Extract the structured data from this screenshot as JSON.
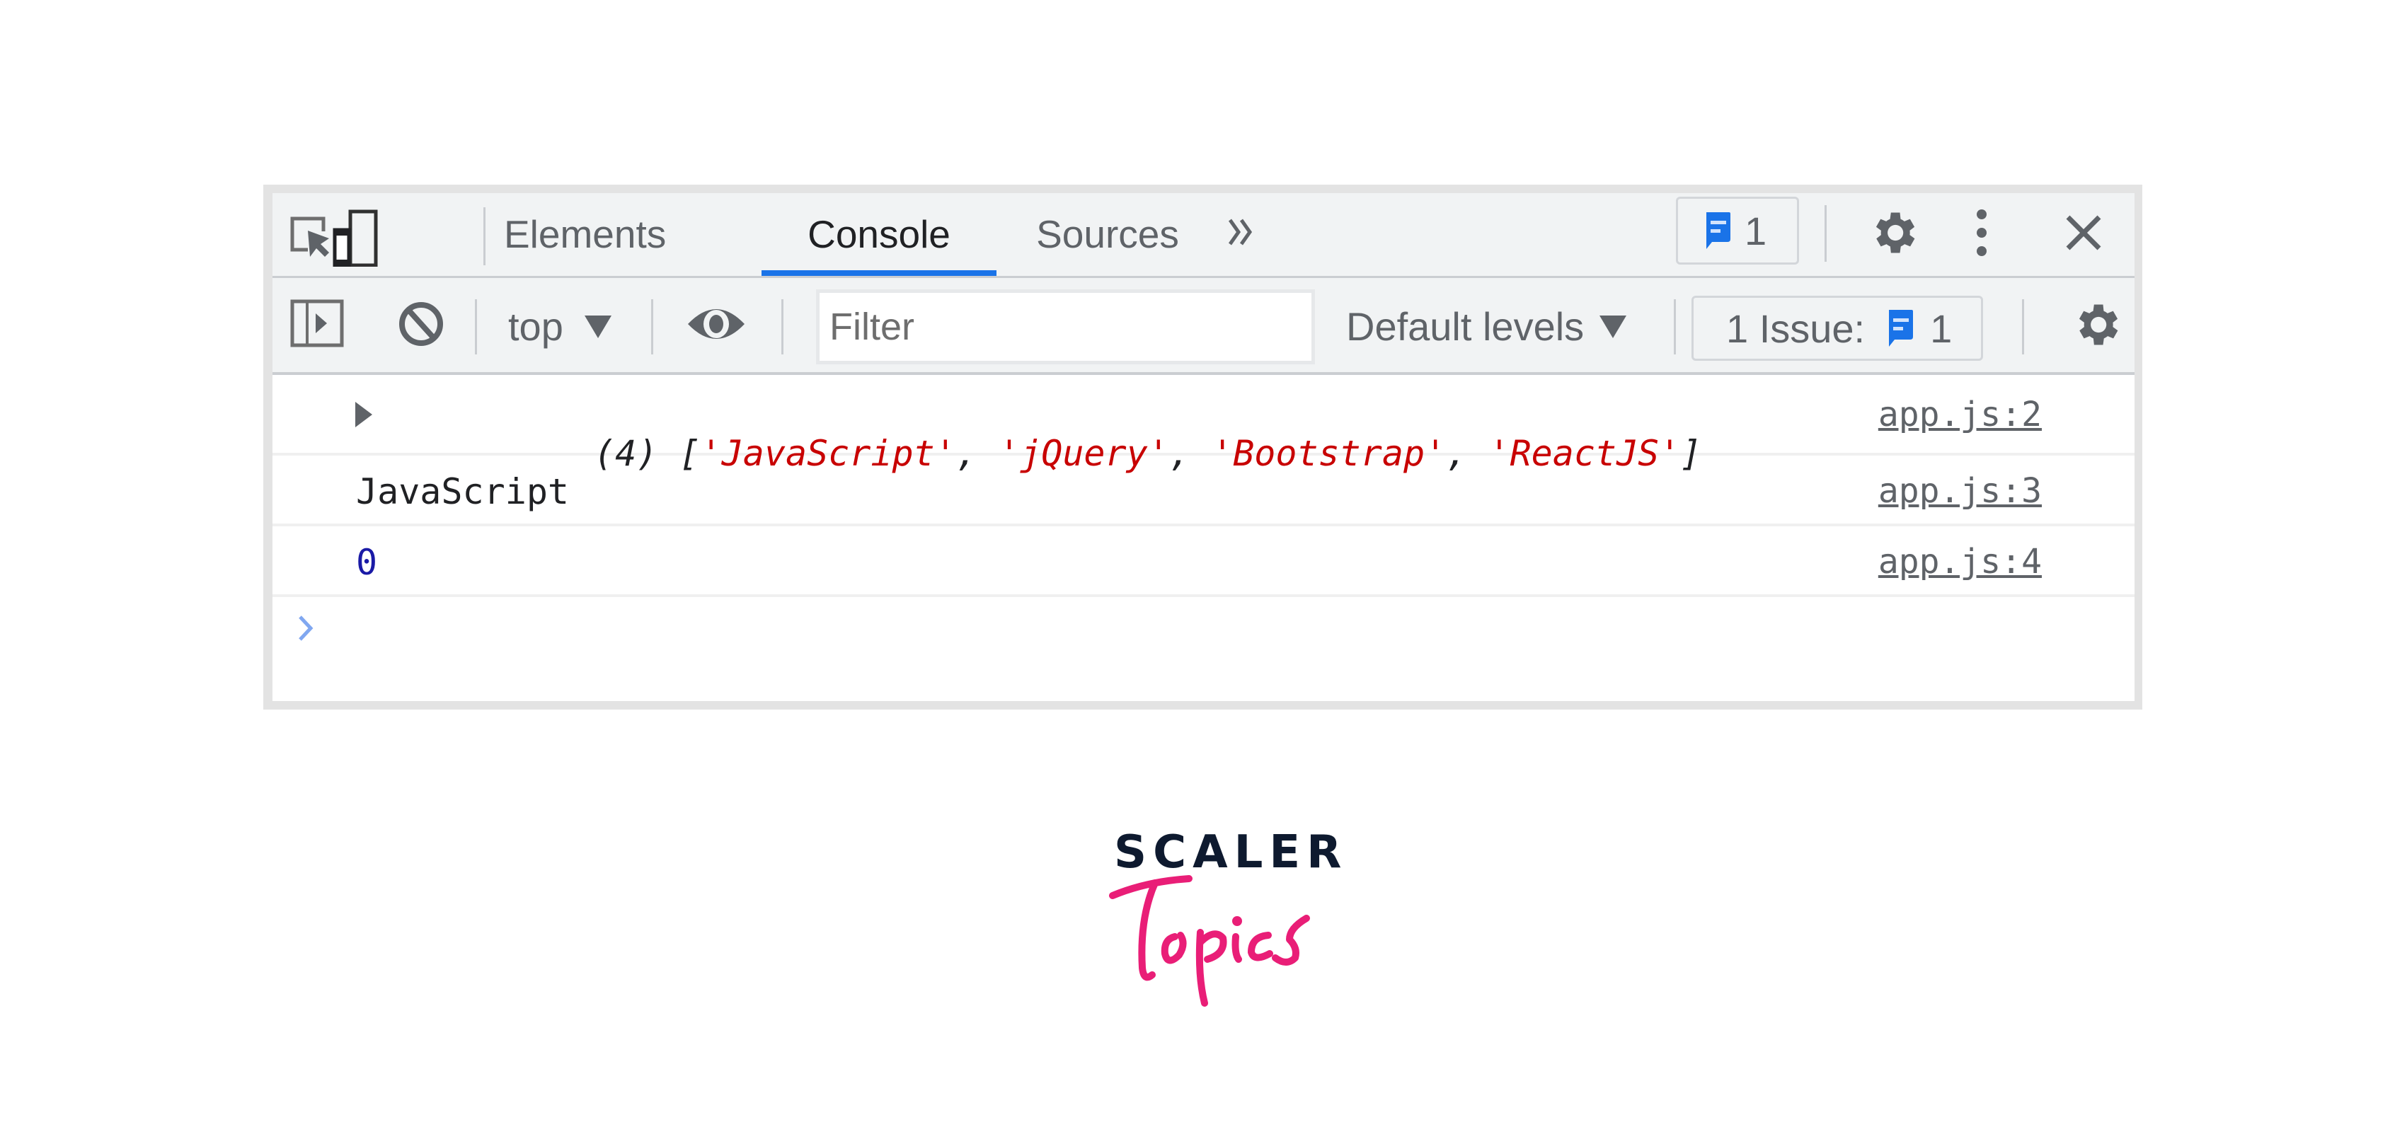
{
  "devtools": {
    "tabs": [
      {
        "label": "Elements",
        "active": false
      },
      {
        "label": "Console",
        "active": true
      },
      {
        "label": "Sources",
        "active": false
      }
    ],
    "more_tabs_icon": "chevrons-right-icon",
    "top_right": {
      "message_badge_count": "1",
      "settings_icon": "gear-icon",
      "menu_icon": "kebab-menu-icon",
      "close_icon": "close-icon"
    },
    "toolbar": {
      "context_select": "top",
      "filter_placeholder": "Filter",
      "filter_value": "",
      "levels_select": "Default levels",
      "issues_label": "1 Issue:",
      "issues_count": "1"
    },
    "console": {
      "rows": [
        {
          "type": "array",
          "prefix": "(4) ",
          "open": "[",
          "items": [
            "'JavaScript'",
            "'jQuery'",
            "'Bootstrap'",
            "'ReactJS'"
          ],
          "sep": ", ",
          "close": "]",
          "source": "app.js:2"
        },
        {
          "type": "string",
          "text": "JavaScript",
          "source": "app.js:3"
        },
        {
          "type": "number",
          "text": "0",
          "source": "app.js:4"
        }
      ],
      "prompt_symbol": "›"
    },
    "colors": {
      "accent": "#1a73e8",
      "string": "#c80000",
      "number": "#1a1aa6"
    }
  },
  "branding": {
    "line1": "SCALER",
    "line2": "Topics",
    "line1_color": "#0e1a2f",
    "line2_color": "#e91e77"
  }
}
